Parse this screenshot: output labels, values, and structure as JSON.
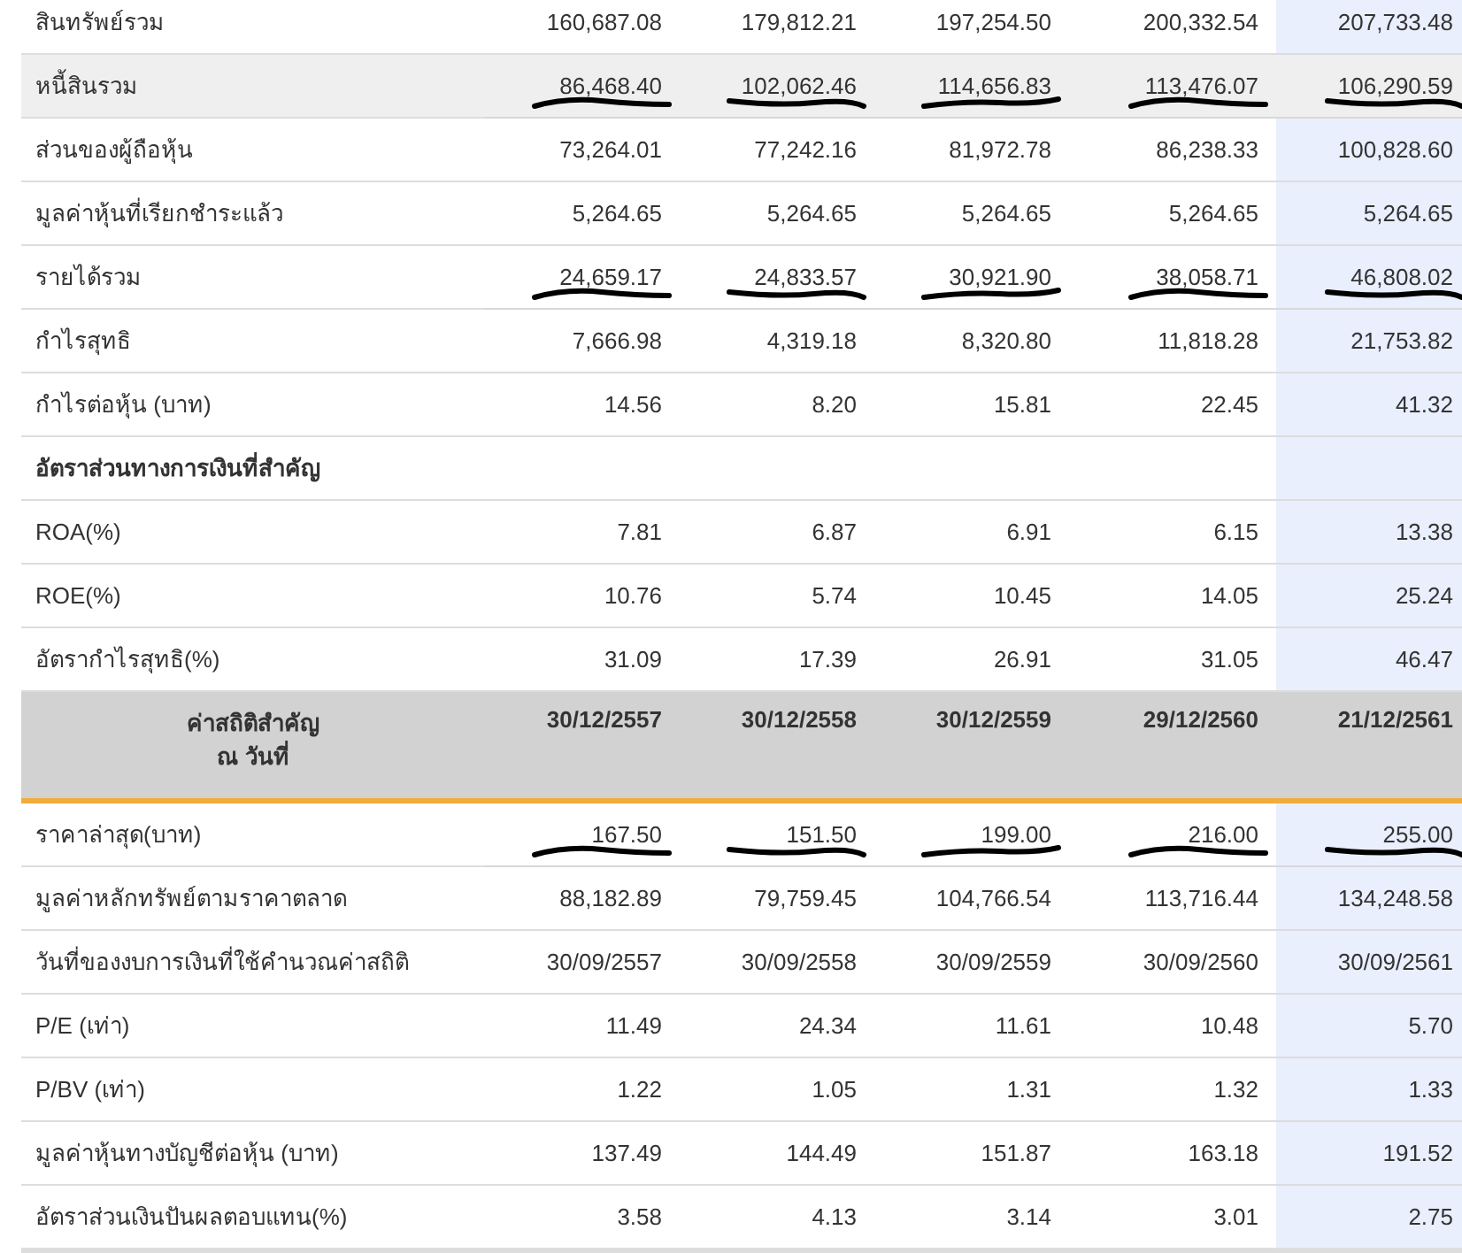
{
  "value_columns": [
    {
      "highlighted": false
    },
    {
      "highlighted": false
    },
    {
      "highlighted": false
    },
    {
      "highlighted": false
    },
    {
      "highlighted": true
    }
  ],
  "rows": [
    {
      "kind": "data",
      "label": "สินทรัพย์รวม",
      "values": [
        "160,687.08",
        "179,812.21",
        "197,254.50",
        "200,332.54",
        "207,733.48"
      ],
      "hovered": false,
      "underlined": false
    },
    {
      "kind": "data",
      "label": "หนี้สินรวม",
      "values": [
        "86,468.40",
        "102,062.46",
        "114,656.83",
        "113,476.07",
        "106,290.59"
      ],
      "hovered": true,
      "underlined": true
    },
    {
      "kind": "data",
      "label": "ส่วนของผู้ถือหุ้น",
      "values": [
        "73,264.01",
        "77,242.16",
        "81,972.78",
        "86,238.33",
        "100,828.60"
      ],
      "hovered": false,
      "underlined": false
    },
    {
      "kind": "data",
      "label": "มูลค่าหุ้นที่เรียกชำระแล้ว",
      "values": [
        "5,264.65",
        "5,264.65",
        "5,264.65",
        "5,264.65",
        "5,264.65"
      ],
      "hovered": false,
      "underlined": false
    },
    {
      "kind": "data",
      "label": "รายได้รวม",
      "values": [
        "24,659.17",
        "24,833.57",
        "30,921.90",
        "38,058.71",
        "46,808.02"
      ],
      "hovered": false,
      "underlined": true
    },
    {
      "kind": "data",
      "label": "กำไรสุทธิ",
      "values": [
        "7,666.98",
        "4,319.18",
        "8,320.80",
        "11,818.28",
        "21,753.82"
      ],
      "hovered": false,
      "underlined": false
    },
    {
      "kind": "data",
      "label": "กำไรต่อหุ้น (บาท)",
      "values": [
        "14.56",
        "8.20",
        "15.81",
        "22.45",
        "41.32"
      ],
      "hovered": false,
      "underlined": false
    },
    {
      "kind": "section",
      "label": "อัตราส่วนทางการเงินที่สำคัญ"
    },
    {
      "kind": "data",
      "label": "ROA(%)",
      "values": [
        "7.81",
        "6.87",
        "6.91",
        "6.15",
        "13.38"
      ],
      "hovered": false,
      "underlined": false
    },
    {
      "kind": "data",
      "label": "ROE(%)",
      "values": [
        "10.76",
        "5.74",
        "10.45",
        "14.05",
        "25.24"
      ],
      "hovered": false,
      "underlined": false
    },
    {
      "kind": "data",
      "label": "อัตรากำไรสุทธิ(%)",
      "values": [
        "31.09",
        "17.39",
        "26.91",
        "31.05",
        "46.47"
      ],
      "hovered": false,
      "underlined": false
    },
    {
      "kind": "header",
      "label_lines": [
        "ค่าสถิติสำคัญ",
        "ณ วันที่"
      ],
      "values": [
        "30/12/2557",
        "30/12/2558",
        "30/12/2559",
        "29/12/2560",
        "21/12/2561"
      ]
    },
    {
      "kind": "data",
      "label": "ราคาล่าสุด(บาท)",
      "values": [
        "167.50",
        "151.50",
        "199.00",
        "216.00",
        "255.00"
      ],
      "hovered": false,
      "underlined": true
    },
    {
      "kind": "data",
      "label": "มูลค่าหลักทรัพย์ตามราคาตลาด",
      "values": [
        "88,182.89",
        "79,759.45",
        "104,766.54",
        "113,716.44",
        "134,248.58"
      ],
      "hovered": false,
      "underlined": false
    },
    {
      "kind": "data",
      "label": "วันที่ของงบการเงินที่ใช้คำนวณค่าสถิติ",
      "values": [
        "30/09/2557",
        "30/09/2558",
        "30/09/2559",
        "30/09/2560",
        "30/09/2561"
      ],
      "hovered": false,
      "underlined": false
    },
    {
      "kind": "data",
      "label": "P/E (เท่า)",
      "values": [
        "11.49",
        "24.34",
        "11.61",
        "10.48",
        "5.70"
      ],
      "hovered": false,
      "underlined": false
    },
    {
      "kind": "data",
      "label": "P/BV (เท่า)",
      "values": [
        "1.22",
        "1.05",
        "1.31",
        "1.32",
        "1.33"
      ],
      "hovered": false,
      "underlined": false
    },
    {
      "kind": "data",
      "label": "มูลค่าหุ้นทางบัญชีต่อหุ้น (บาท)",
      "values": [
        "137.49",
        "144.49",
        "151.87",
        "163.18",
        "191.52"
      ],
      "hovered": false,
      "underlined": false
    },
    {
      "kind": "data",
      "label": "อัตราส่วนเงินปันผลตอบแทน(%)",
      "values": [
        "3.58",
        "4.13",
        "3.14",
        "3.01",
        "2.75"
      ],
      "hovered": false,
      "underlined": false
    }
  ]
}
